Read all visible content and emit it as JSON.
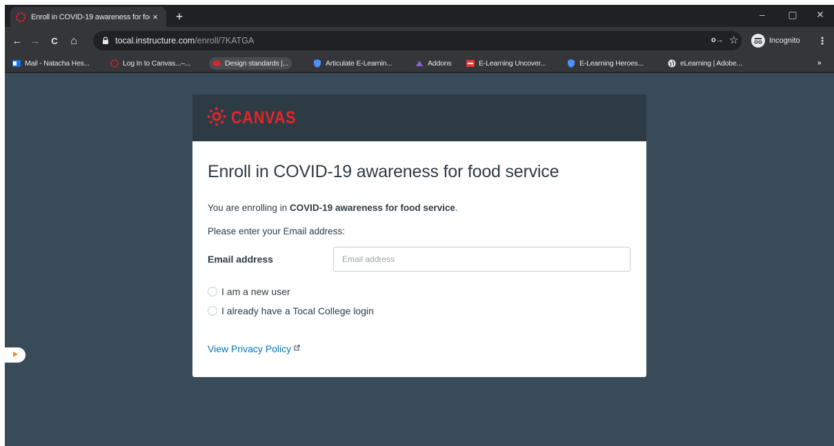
{
  "browser": {
    "tab_title": "Enroll in COVID-19 awareness for food service",
    "new_tab": "+",
    "tab_close": "×",
    "url_host": "tocal.instructure.com",
    "url_path": "/enroll/7KATGA",
    "incognito_label": "Incognito",
    "window_minimize": "–",
    "window_restore": "▢",
    "window_close": "✕",
    "nav_back": "←",
    "nav_forward": "→",
    "nav_reload": "C",
    "nav_home": "⌂",
    "key_icon": "o→",
    "star_icon": "☆",
    "menu": "⋮"
  },
  "bookmarks": [
    {
      "label": "Mail - Natacha Hes...",
      "icon": "outlook-icon",
      "color": "#1a73e8"
    },
    {
      "label": "Log In to Canvas...–...",
      "icon": "canvas-icon",
      "color": "#e72429"
    },
    {
      "label": "Design standards |...",
      "icon": "design-icon",
      "color": "#d9272e"
    },
    {
      "label": "Articulate E-Learnin...",
      "icon": "shield-icon",
      "color": "#4d90fe"
    },
    {
      "label": "Addons",
      "icon": "addons-icon",
      "color": "#8a63d2"
    },
    {
      "label": "E-Learning Uncover...",
      "icon": "elu-icon",
      "color": "#e53935"
    },
    {
      "label": "E-Learning Heroes...",
      "icon": "shield-icon",
      "color": "#4d90fe"
    },
    {
      "label": "eLearning | Adobe...",
      "icon": "globe-icon",
      "color": "#e8eaed"
    }
  ],
  "bookmarks_more": "»",
  "card": {
    "brand": "CANVAS",
    "brand_color": "#e72429",
    "heading": "Enroll in COVID-19 awareness for food service",
    "intro_prefix": "You are enrolling in ",
    "intro_course": "COVID-19 awareness for food service",
    "intro_suffix": ".",
    "prompt": "Please enter your Email address:",
    "email_label": "Email address",
    "email_placeholder": "Email address",
    "email_value": "",
    "radio_new_user": "I am a new user",
    "radio_existing": "I already have a Tocal College login",
    "privacy_link": "View Privacy Policy",
    "link_color": "#0374b5"
  }
}
